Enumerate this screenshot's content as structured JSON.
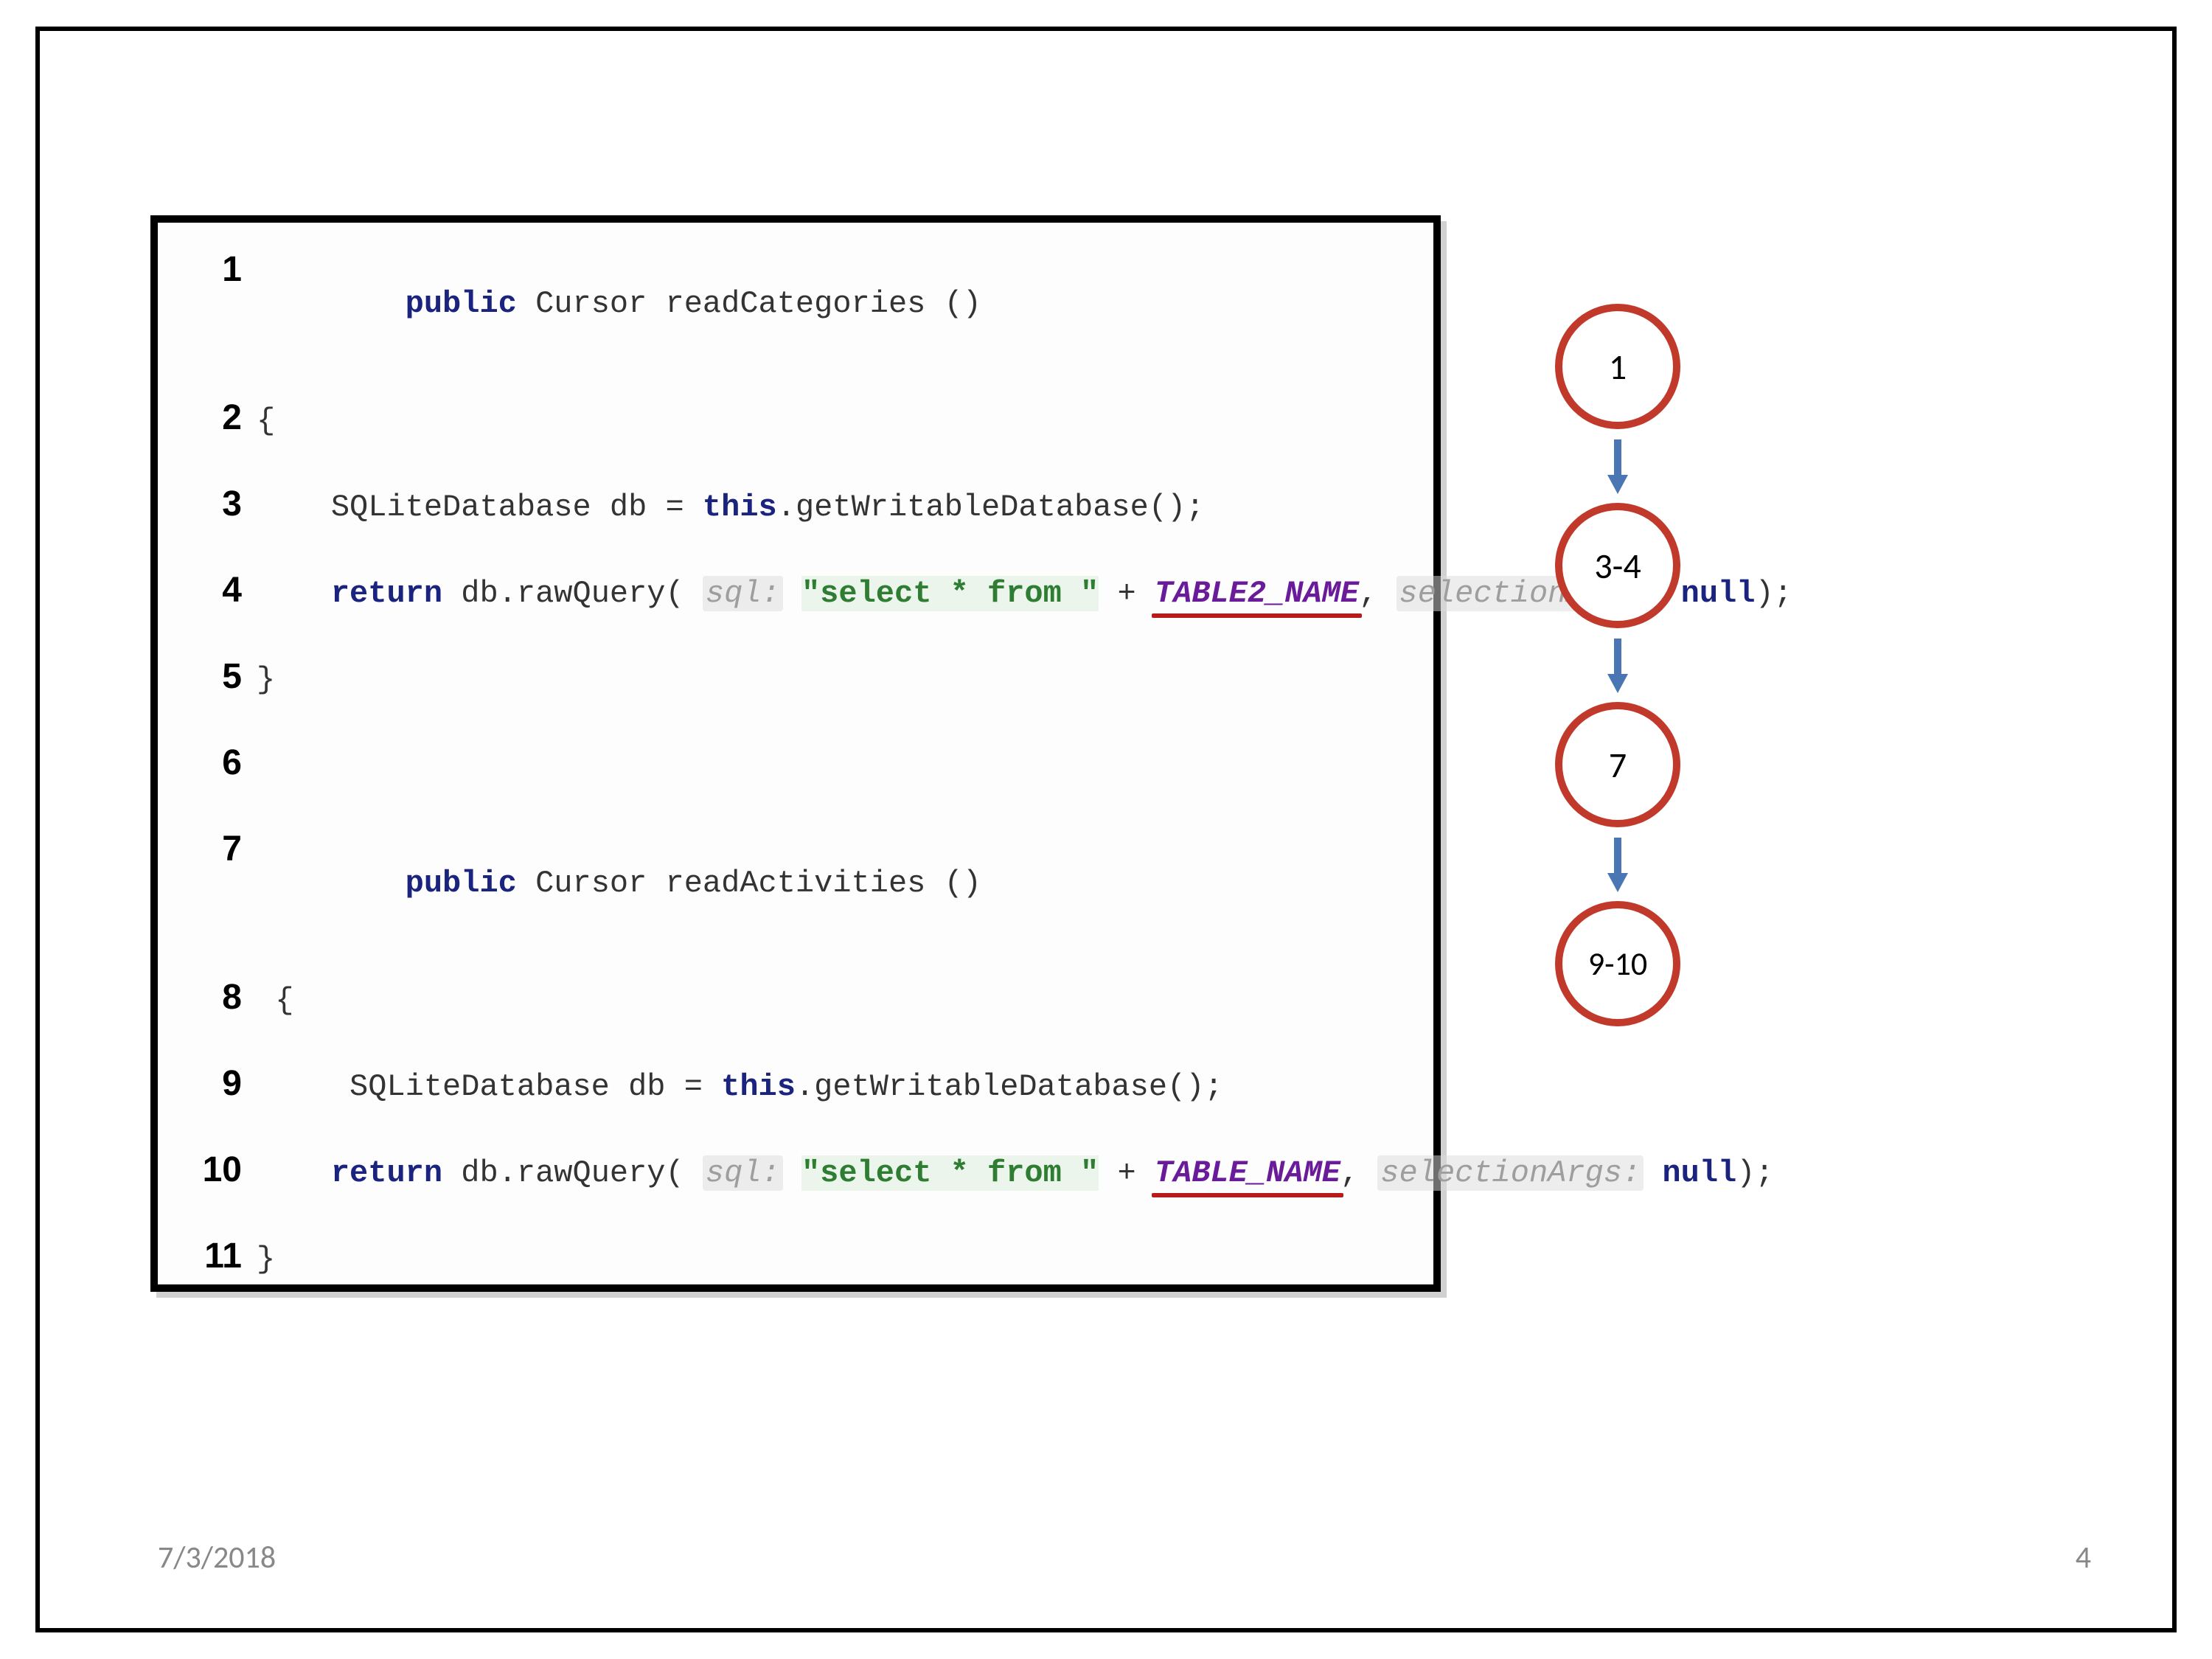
{
  "code": {
    "lines": [
      {
        "n": "1",
        "kw1": "public",
        "t1": " Cursor readCategories ()"
      },
      {
        "n": "2",
        "brace": "{"
      },
      {
        "n": "3",
        "indent": "    ",
        "t1": "SQLiteDatabase db = ",
        "kw_this": "this",
        "t2": ".getWritableDatabase();"
      },
      {
        "n": "4",
        "indent": "    ",
        "kw1": "return",
        "t1": " db.rawQuery( ",
        "hint1": "sql:",
        "t2": " ",
        "str1": "\"select * from \"",
        "t3": " + ",
        "const1": "TABLE2_NAME",
        "t4": ", ",
        "hint2": "selectionArgs:",
        "t5": " ",
        "kw2": "null",
        "t6": ");"
      },
      {
        "n": "5",
        "brace": "}"
      },
      {
        "n": "6",
        "blank": " "
      },
      {
        "n": "7",
        "kw1": "public",
        "t1": " Cursor readActivities ()"
      },
      {
        "n": "8",
        "brace": " {",
        "indent": ""
      },
      {
        "n": "9",
        "indent": "     ",
        "t1": "SQLiteDatabase db = ",
        "kw_this": "this",
        "t2": ".getWritableDatabase();"
      },
      {
        "n": "10",
        "indent": "    ",
        "kw1": "return",
        "t1": " db.rawQuery( ",
        "hint1": "sql:",
        "t2": " ",
        "str1": "\"select * from \"",
        "t3": " + ",
        "const1": "TABLE_NAME",
        "t4": ", ",
        "hint2": "selectionArgs:",
        "t5": " ",
        "kw2": "null",
        "t6": ");"
      },
      {
        "n": "11",
        "brace": "}"
      }
    ]
  },
  "flow": {
    "nodes": [
      "1",
      "3-4",
      "7",
      "9-10"
    ]
  },
  "footer": {
    "date": "7/3/2018",
    "page": "4"
  },
  "colors": {
    "node_border": "#c0392b",
    "arrow": "#4a77b4",
    "underline": "#b71c1c"
  }
}
